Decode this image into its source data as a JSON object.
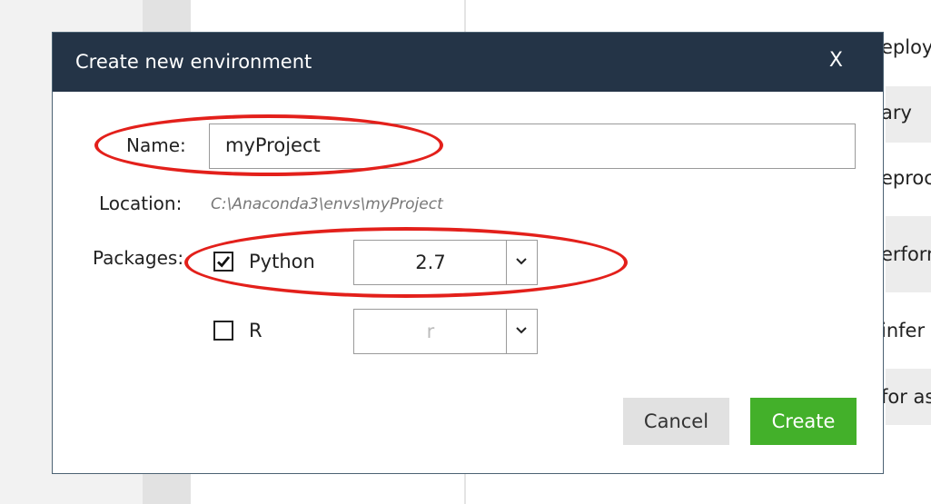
{
  "background": {
    "texts": [
      "eploy",
      "ary",
      "eproc",
      "erform",
      "infer",
      "for as"
    ]
  },
  "dialog": {
    "title": "Create new environment",
    "close_label": "X",
    "name_label": "Name:",
    "name_value": "myProject",
    "location_label": "Location:",
    "location_value": "C:\\Anaconda3\\envs\\myProject",
    "packages_label": "Packages:",
    "packages": [
      {
        "name": "Python",
        "checked": true,
        "version": "2.7"
      },
      {
        "name": "R",
        "checked": false,
        "version": "r"
      }
    ],
    "cancel_label": "Cancel",
    "create_label": "Create"
  },
  "colors": {
    "titlebar": "#243447",
    "create_button": "#43b02a",
    "cancel_button": "#e1e1e1",
    "annotation": "#e3201b"
  },
  "icons": [
    "close-icon",
    "checkmark-icon",
    "chevron-down-icon"
  ]
}
